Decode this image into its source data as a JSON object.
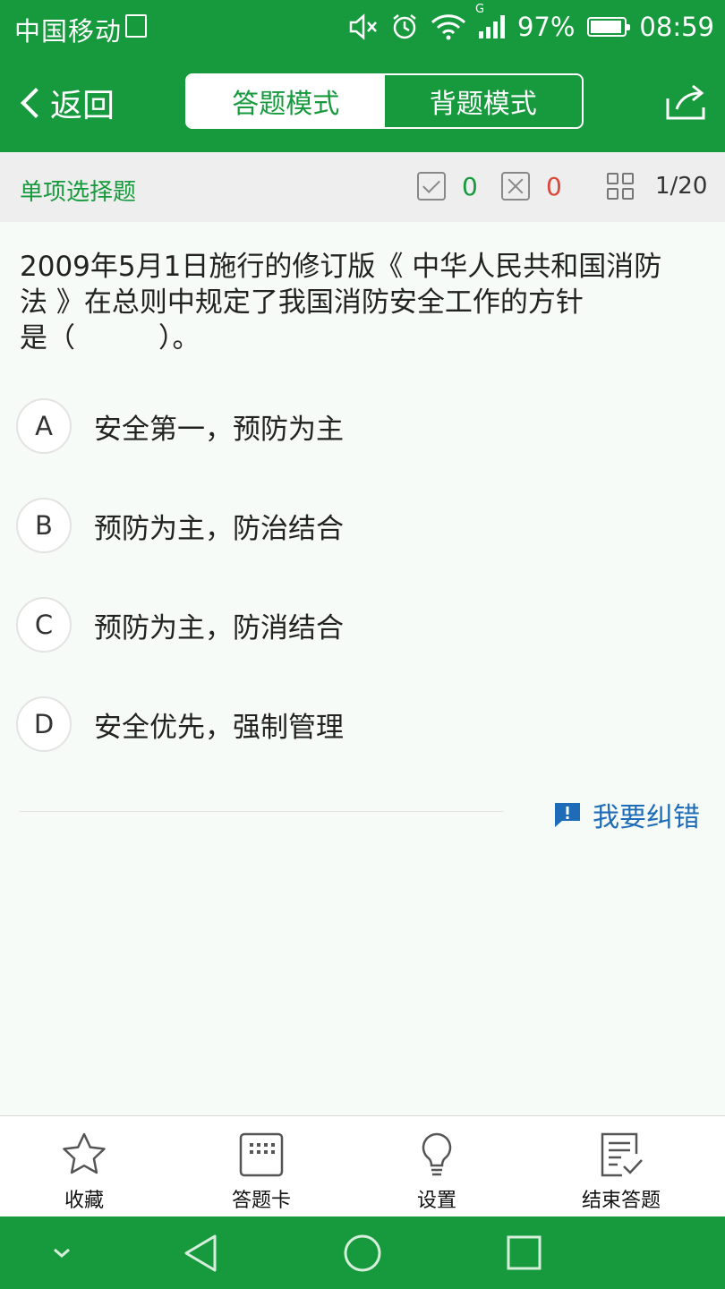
{
  "status_bar": {
    "carrier": "中国移动",
    "network": "G",
    "battery": "97%",
    "time": "08:59"
  },
  "header": {
    "back_label": "返回",
    "tabs": [
      {
        "label": "答题模式",
        "active": true
      },
      {
        "label": "背题模式",
        "active": false
      }
    ],
    "share_icon": "share-icon"
  },
  "info_bar": {
    "question_type": "单项选择题",
    "correct_count": "0",
    "wrong_count": "0",
    "progress": "1/20"
  },
  "question": {
    "lines": [
      "2009年5月1日施行的修订版《 中华人民共和国消防",
      "法 》在总则中规定了我国消防安全工作的方针",
      "是（　　　）。"
    ]
  },
  "options": [
    {
      "letter": "A",
      "text": "安全第一，预防为主"
    },
    {
      "letter": "B",
      "text": "预防为主，防治结合"
    },
    {
      "letter": "C",
      "text": "预防为主，防消结合"
    },
    {
      "letter": "D",
      "text": "安全优先，强制管理"
    }
  ],
  "report_label": "我要纠错",
  "toolbar": [
    {
      "label": "收藏",
      "icon": "star-icon"
    },
    {
      "label": "答题卡",
      "icon": "answer-card-icon"
    },
    {
      "label": "设置",
      "icon": "lightbulb-icon"
    },
    {
      "label": "结束答题",
      "icon": "finish-sheet-icon"
    }
  ],
  "colors": {
    "primary": "#169a3d",
    "wrong": "#d9483b",
    "link": "#1e6cb8"
  }
}
